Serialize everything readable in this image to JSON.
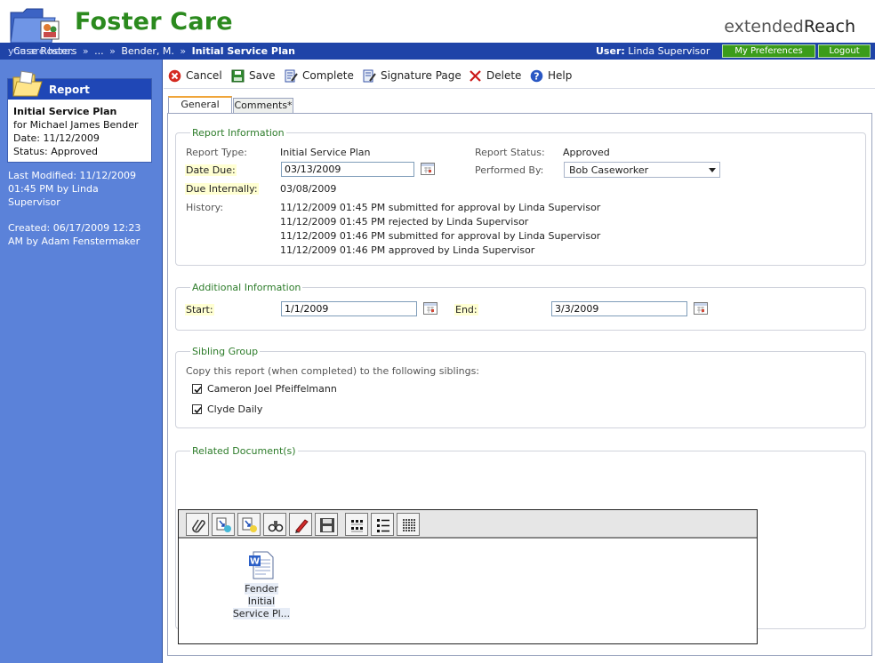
{
  "app": {
    "title": "Foster Care",
    "brand_light": "extended",
    "brand_bold": "Reach"
  },
  "breadcrumb": {
    "label": "you are here:",
    "items": [
      "Case Rosters",
      "...",
      "Bender, M."
    ],
    "current": "Initial Service Plan",
    "separator": "»"
  },
  "user": {
    "label": "User:",
    "name": "Linda Supervisor"
  },
  "top_buttons": {
    "preferences": "My Preferences",
    "logout": "Logout"
  },
  "sidebar": {
    "card_title": "Report",
    "report_name": "Initial Service Plan",
    "for_line": "for Michael James Bender",
    "date_line": "Date: 11/12/2009",
    "status_line": "Status: Approved",
    "last_modified": [
      "Last Modified: 11/12/2009",
      "01:45 PM by Linda",
      "Supervisor"
    ],
    "created": [
      "Created: 06/17/2009 12:23",
      "AM by Adam Fenstermaker"
    ]
  },
  "toolbar": {
    "cancel": "Cancel",
    "save": "Save",
    "complete": "Complete",
    "signature": "Signature Page",
    "delete": "Delete",
    "help": "Help"
  },
  "tabs": {
    "general": "General",
    "comments": "Comments*"
  },
  "report_info": {
    "legend": "Report Information",
    "type_label": "Report Type:",
    "type_value": "Initial Service Plan",
    "status_label": "Report Status:",
    "status_value": "Approved",
    "date_due_label": "Date Due:",
    "date_due_value": "03/13/2009",
    "performed_label": "Performed By:",
    "performed_value": "Bob Caseworker",
    "due_internally_label": "Due Internally:",
    "due_internally_value": "03/08/2009",
    "history_label": "History:",
    "history": [
      "11/12/2009 01:45 PM submitted for approval by Linda Supervisor",
      "11/12/2009 01:45 PM rejected by Linda Supervisor",
      "11/12/2009 01:46 PM submitted for approval by Linda Supervisor",
      "11/12/2009 01:46 PM approved by Linda Supervisor"
    ]
  },
  "additional_info": {
    "legend": "Additional Information",
    "start_label": "Start:",
    "start_value": "1/1/2009",
    "end_label": "End:",
    "end_value": "3/3/2009"
  },
  "sibling_group": {
    "legend": "Sibling Group",
    "instruction": "Copy this report (when completed) to the following siblings:",
    "siblings": [
      {
        "name": "Cameron Joel Pfeiffelmann",
        "checked": true
      },
      {
        "name": "Clyde Daily",
        "checked": true
      }
    ]
  },
  "related_docs": {
    "legend": "Related Document(s)",
    "file_line1": "Fender Initial",
    "file_line2": "Service Pl..."
  },
  "colors": {
    "title_green": "#2b8a1e",
    "nav_blue": "#1f44a8",
    "sidebar_blue": "#5b82d9",
    "legend_green": "#2d7c2a",
    "highlight": "#ffffd2"
  }
}
